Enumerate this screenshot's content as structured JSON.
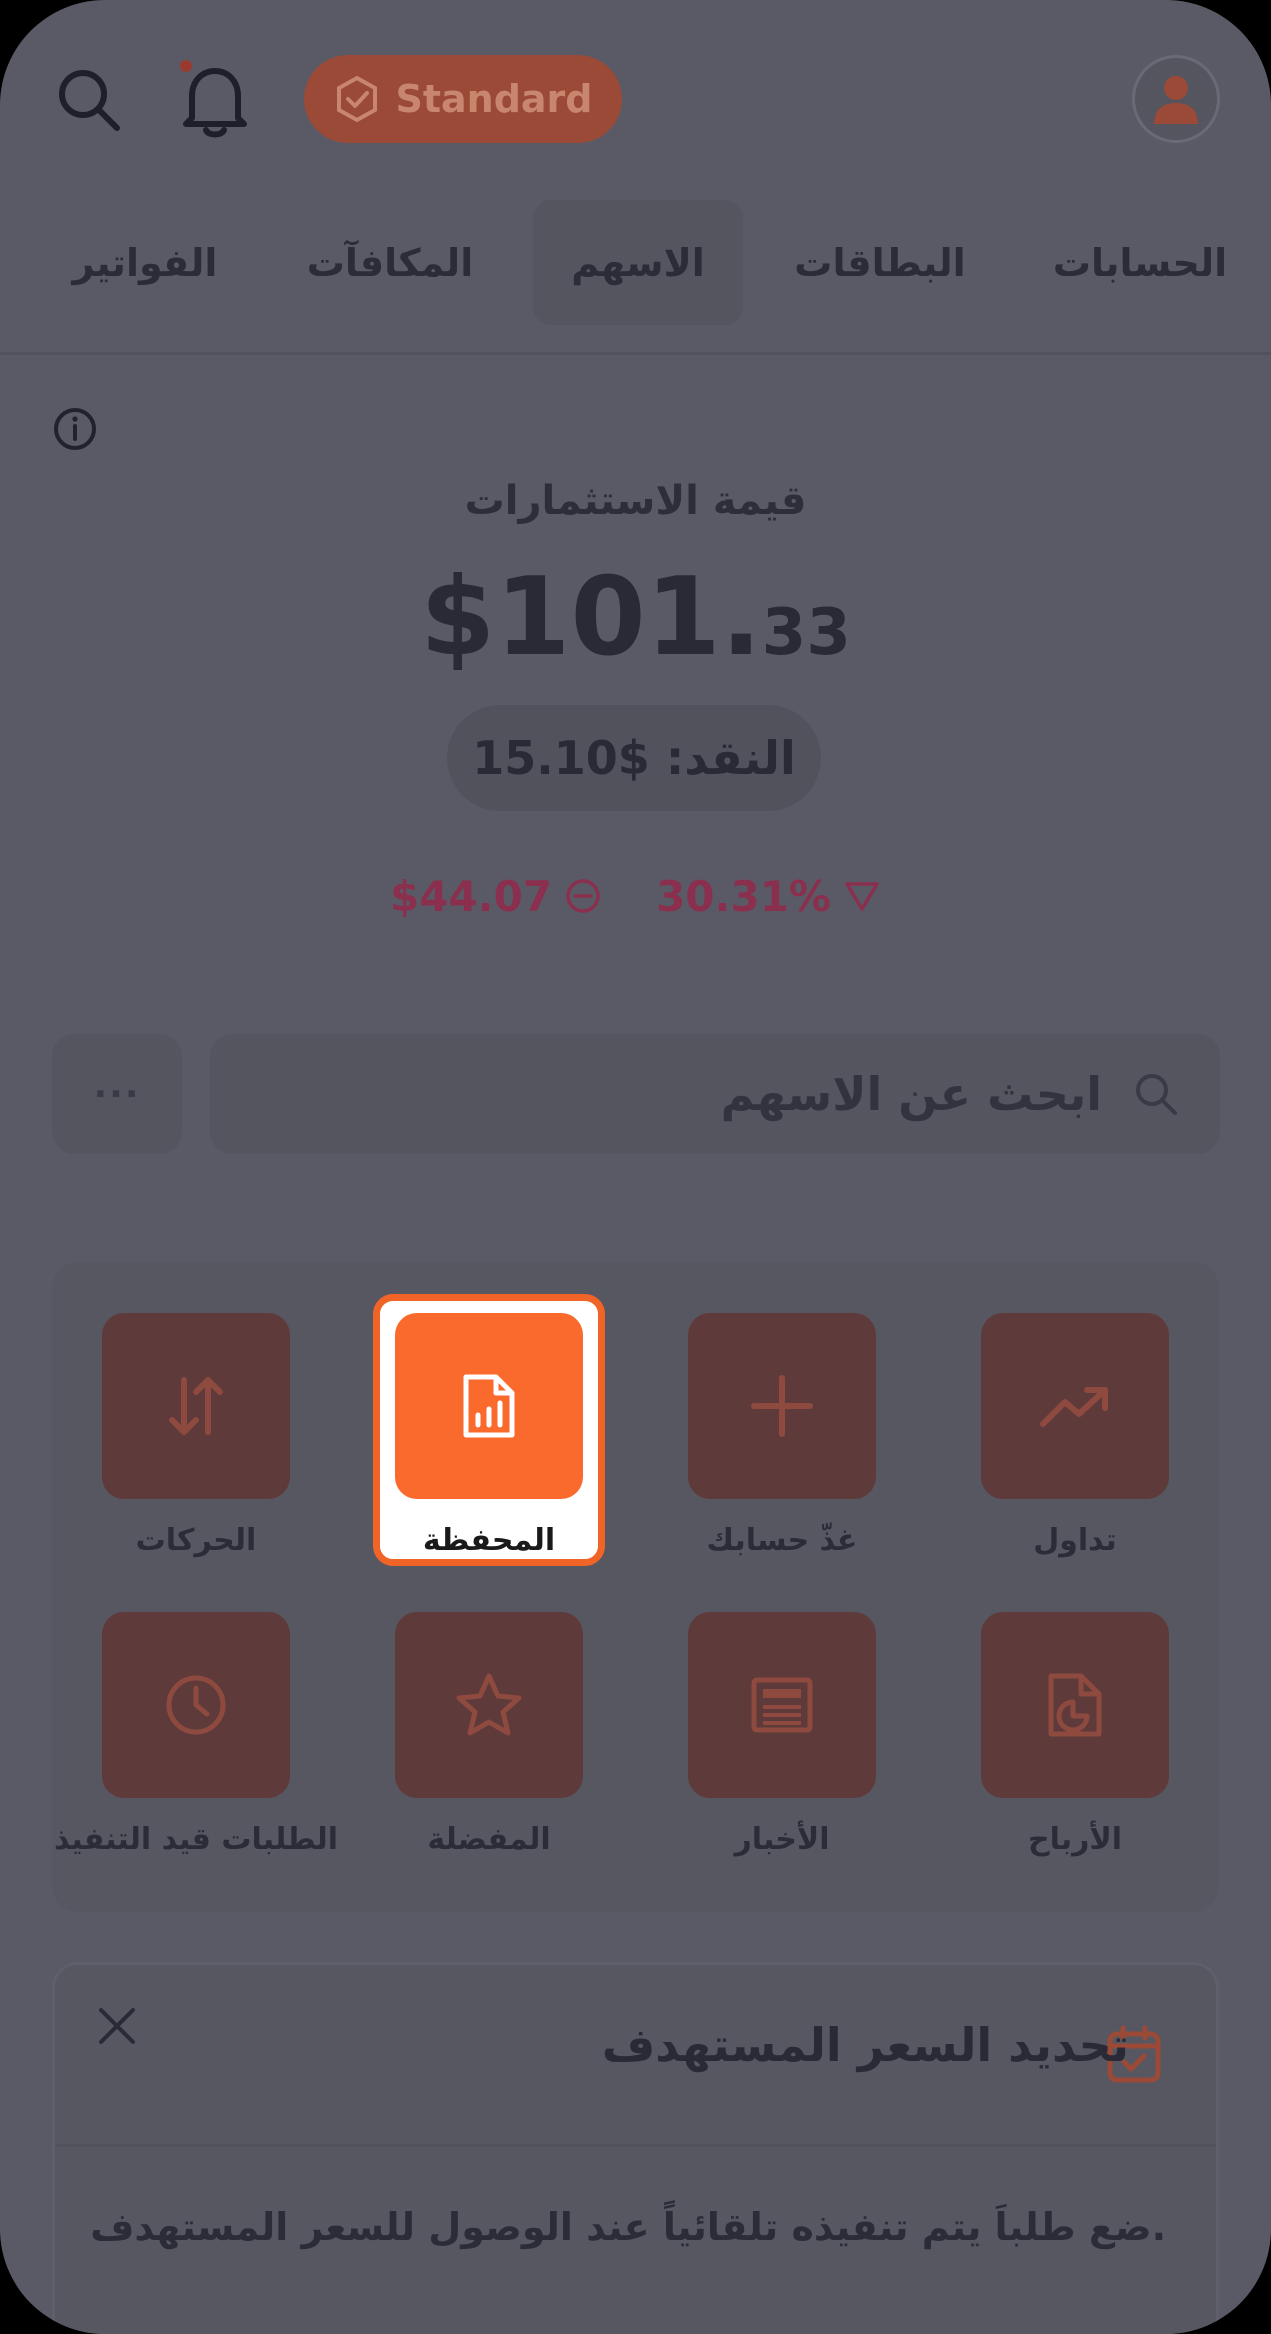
{
  "header": {
    "badge_label": "Standard",
    "icons": {
      "search": "search-icon",
      "notifications": "bell-icon",
      "badge": "check-badge-icon",
      "profile": "user-icon"
    }
  },
  "tabs": [
    {
      "label": "الحسابات",
      "active": false
    },
    {
      "label": "البطاقات",
      "active": false
    },
    {
      "label": "الاسهم",
      "active": true
    },
    {
      "label": "المكافآت",
      "active": false
    },
    {
      "label": "الفواتير",
      "active": false
    }
  ],
  "portfolio": {
    "investments_label": "قيمة الاستثمارات",
    "investments_whole": "$101.",
    "investments_cents": "33",
    "cash_label": "النقد: $15.10",
    "change_percent": "30.31%",
    "change_amount": "$44.07"
  },
  "search": {
    "placeholder": "ابحث عن الاسهم",
    "more_label": "···"
  },
  "actions": [
    {
      "label": "تداول",
      "icon": "trending-up-icon"
    },
    {
      "label": "غذّ حسابك",
      "icon": "plus-icon"
    },
    {
      "label": "المحفظة",
      "icon": "portfolio-report-icon",
      "highlighted": true
    },
    {
      "label": "الحركات",
      "icon": "transfer-arrows-icon"
    },
    {
      "label": "الأرباح",
      "icon": "dividends-icon"
    },
    {
      "label": "الأخبار",
      "icon": "news-icon"
    },
    {
      "label": "المفضلة",
      "icon": "star-icon"
    },
    {
      "label": "الطلبات قيد التنفيذ",
      "icon": "clock-icon"
    }
  ],
  "target_card": {
    "title": "تحديد السعر المستهدف",
    "description": "ضع طلباَ يتم تنفيذه تلقائياً عند الوصول للسعر المستهدف."
  },
  "colors": {
    "overlay": "#5a5a66",
    "accent": "#fb6a2d",
    "negative": "#8a2f4d"
  }
}
